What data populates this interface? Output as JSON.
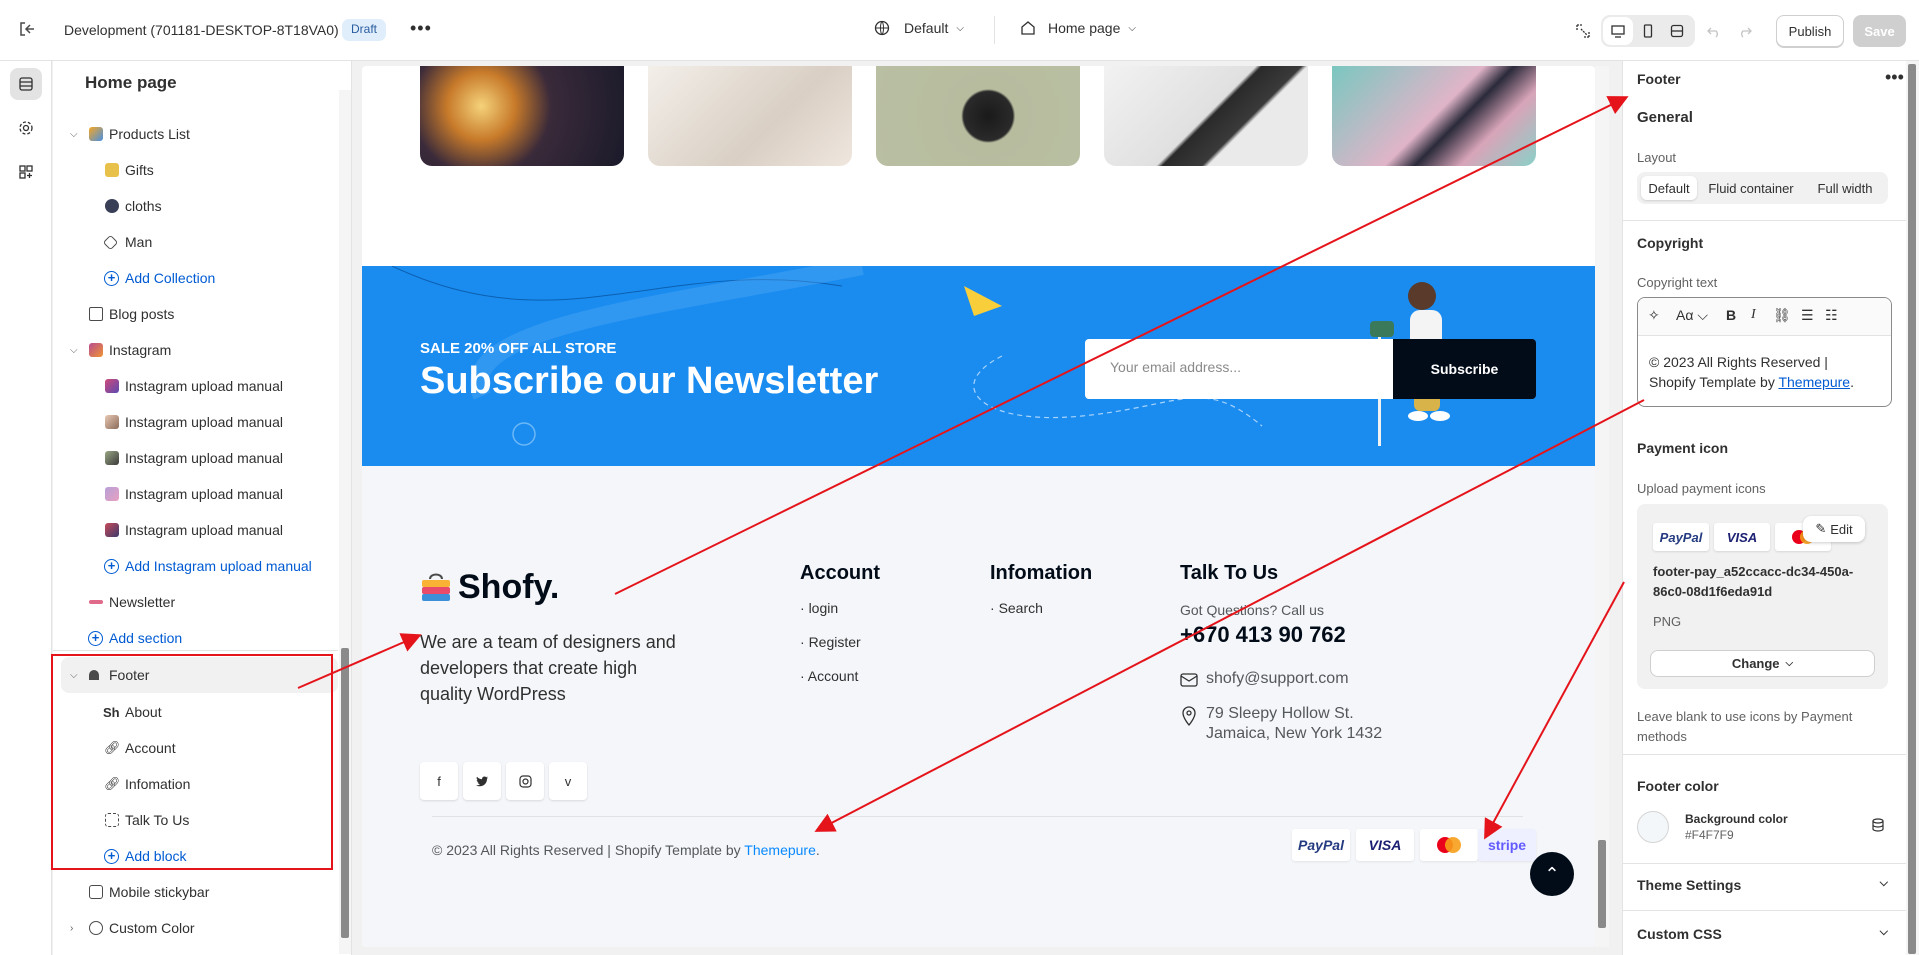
{
  "topbar": {
    "title": "Development (701181-DESKTOP-8T18VA0)",
    "badge": "Draft",
    "more": "•••",
    "theme": "Default",
    "page": "Home page",
    "publish": "Publish",
    "save": "Save"
  },
  "sidebar": {
    "heading": "Home page",
    "items": [
      {
        "label": "Products List"
      },
      {
        "label": "Gifts"
      },
      {
        "label": "cloths"
      },
      {
        "label": "Man"
      },
      {
        "label": "Add Collection"
      },
      {
        "label": "Blog posts"
      },
      {
        "label": "Instagram"
      },
      {
        "label": "Instagram upload manual"
      },
      {
        "label": "Instagram upload manual"
      },
      {
        "label": "Instagram upload manual"
      },
      {
        "label": "Instagram upload manual"
      },
      {
        "label": "Instagram upload manual"
      },
      {
        "label": "Add Instagram upload manual"
      },
      {
        "label": "Newsletter"
      },
      {
        "label": "Add section"
      },
      {
        "label": "Footer"
      },
      {
        "label": "About"
      },
      {
        "label": "Account"
      },
      {
        "label": "Infomation"
      },
      {
        "label": "Talk To Us"
      },
      {
        "label": "Add block"
      },
      {
        "label": "Mobile stickybar"
      },
      {
        "label": "Custom Color"
      }
    ]
  },
  "canvas": {
    "newsletter": {
      "sale": "SALE 20% OFF ALL STORE",
      "title": "Subscribe our Newsletter",
      "placeholder": "Your email address...",
      "button": "Subscribe"
    },
    "footer": {
      "logo": "Shofy.",
      "description": "We are a team of designers and developers that create high quality WordPress",
      "account_heading": "Account",
      "account_links": [
        "login",
        "Register",
        "Account"
      ],
      "info_heading": "Infomation",
      "info_links": [
        "Search"
      ],
      "talk_heading": "Talk To Us",
      "question": "Got Questions? Call us",
      "phone": "+670 413 90 762",
      "email": "shofy@support.com",
      "address_line1": "79 Sleepy Hollow St.",
      "address_line2": "Jamaica, New York 1432",
      "copyright": "© 2023 All Rights Reserved | Shopify Template by",
      "copyright_link": "Themepure",
      "payments": [
        "PayPal",
        "VISA",
        "mastercard",
        "stripe"
      ]
    }
  },
  "panel": {
    "title": "Footer",
    "general": "General",
    "layout_label": "Layout",
    "layout_options": [
      "Default",
      "Fluid container",
      "Full width"
    ],
    "layout_selected": "Default",
    "copyright_heading": "Copyright",
    "copyright_label": "Copyright text",
    "copyright_text_1": "© 2023 All Rights Reserved |",
    "copyright_text_2": "Shopify Template by",
    "copyright_link": "Themepure",
    "payment_heading": "Payment icon",
    "upload_label": "Upload payment icons",
    "edit": "Edit",
    "file_name": "footer-pay_a52ccacc-dc34-450a-86c0-08d1f6eda91d",
    "file_type": "PNG",
    "change": "Change",
    "hint": "Leave blank to use icons by Payment methods",
    "footer_color_heading": "Footer color",
    "bg_label": "Background color",
    "bg_value": "#F4F7F9",
    "theme_settings": "Theme Settings",
    "custom_css": "Custom CSS"
  },
  "colors": {
    "accent": "#005bd3",
    "annotation": "#e5141b",
    "newsletter_bg": "#1a8cf0"
  }
}
